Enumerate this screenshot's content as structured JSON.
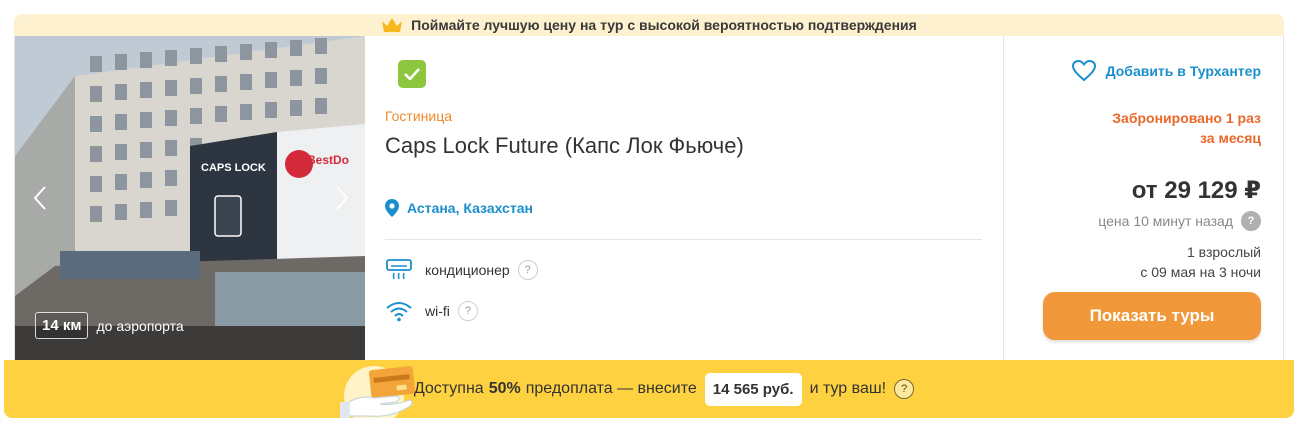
{
  "banner": {
    "text": "Поймайте лучшую цену на тур с высокой вероятностью подтверждения",
    "icon": "crown-icon",
    "bg": "#fdf1cf"
  },
  "photo": {
    "distance_value": "14 км",
    "distance_label": "до аэропорта",
    "sign_caps": "CAPS LOCK",
    "sign_bestdo": "BestDo"
  },
  "hotel": {
    "type": "Гостиница",
    "name": "Caps Lock Future (Капс Лок Фьюче)",
    "location": "Астана, Казахстан",
    "amenities": [
      {
        "label": "кондиционер",
        "icon": "air-conditioner-icon",
        "help": "?"
      },
      {
        "label": "wi-fi",
        "icon": "wifi-icon",
        "help": "?"
      }
    ]
  },
  "pricing": {
    "wishlist_label": "Добавить в Турхантер",
    "booked_line1": "Забронировано 1 раз",
    "booked_line2": "за месяц",
    "price": "от 29 129 ₽",
    "price_age": "цена 10 минут назад",
    "price_help": "?",
    "pax_line1": "1 взрослый",
    "pax_line2": "с 09 мая на 3 ночи",
    "button_label": "Показать туры"
  },
  "prepay": {
    "text_before": "Доступна",
    "percent": "50%",
    "text_middle": "предоплата — внесите",
    "amount": "14 565 руб.",
    "text_after": "и тур ваш!",
    "help": "?"
  },
  "colors": {
    "accent_blue": "#1a8fcc",
    "accent_orange": "#f08a2a",
    "button": "#f0983a",
    "prepay_bg": "#fdd13f",
    "check_green": "#8cc63f"
  }
}
